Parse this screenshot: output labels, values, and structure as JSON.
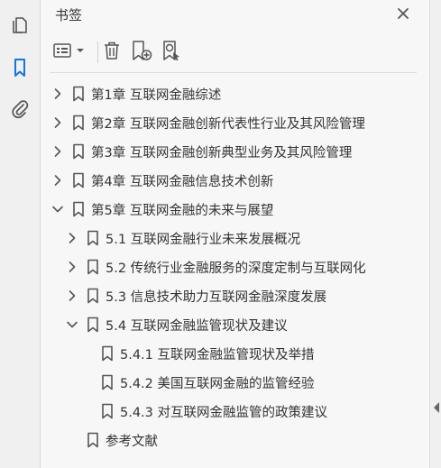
{
  "panel": {
    "title": "书签"
  },
  "outline": [
    {
      "label": "第1章 互联网金融综述",
      "level": 0,
      "toggle": "collapsed"
    },
    {
      "label": "第2章 互联网金融创新代表性行业及其风险管理",
      "level": 0,
      "toggle": "collapsed"
    },
    {
      "label": "第3章 互联网金融创新典型业务及其风险管理",
      "level": 0,
      "toggle": "collapsed"
    },
    {
      "label": "第4章 互联网金融信息技术创新",
      "level": 0,
      "toggle": "collapsed"
    },
    {
      "label": "第5章 互联网金融的未来与展望",
      "level": 0,
      "toggle": "expanded"
    },
    {
      "label": "5.1 互联网金融行业未来发展概况",
      "level": 1,
      "toggle": "collapsed"
    },
    {
      "label": "5.2 传统行业金融服务的深度定制与互联网化",
      "level": 1,
      "toggle": "collapsed"
    },
    {
      "label": "5.3 信息技术助力互联网金融深度发展",
      "level": 1,
      "toggle": "collapsed"
    },
    {
      "label": "5.4 互联网金融监管现状及建议",
      "level": 1,
      "toggle": "expanded"
    },
    {
      "label": "5.4.1 互联网金融监管现状及举措",
      "level": 2,
      "toggle": "none"
    },
    {
      "label": "5.4.2 美国互联网金融的监管经验",
      "level": 2,
      "toggle": "none"
    },
    {
      "label": "5.4.3 对互联网金融监管的政策建议",
      "level": 2,
      "toggle": "none"
    },
    {
      "label": "参考文献",
      "level": 1,
      "toggle": "none"
    }
  ],
  "icons": {
    "rail": [
      "pages-icon",
      "bookmark-icon",
      "attachment-icon"
    ],
    "toolbar": [
      "options-menu-icon",
      "delete-icon",
      "new-bookmark-icon",
      "bookmark-search-icon"
    ],
    "close": "close-icon"
  },
  "colors": {
    "accent": "#1473e6",
    "icon": "#555555",
    "text": "#333333"
  }
}
